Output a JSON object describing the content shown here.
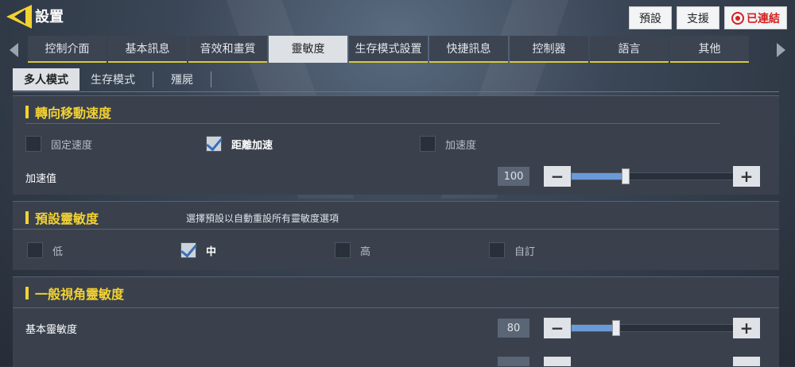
{
  "header": {
    "title": "設置",
    "buttons": [
      "預設",
      "支援"
    ],
    "connected_label": "已連結"
  },
  "tabs": [
    "控制介面",
    "基本訊息",
    "音效和畫質",
    "靈敏度",
    "生存模式設置",
    "快捷訊息",
    "控制器",
    "語言",
    "其他"
  ],
  "active_tab": "靈敏度",
  "subtabs": [
    "多人模式",
    "生存模式",
    "殭屍"
  ],
  "active_subtab": "多人模式",
  "sec1": {
    "title": "轉向移動速度",
    "options": [
      {
        "label": "固定速度",
        "checked": false
      },
      {
        "label": "距離加速",
        "checked": true
      },
      {
        "label": "加速度",
        "checked": false
      }
    ],
    "slider": {
      "label": "加速值",
      "value": "100",
      "fraction": 0.33
    }
  },
  "sec2": {
    "title": "預設靈敏度",
    "hint": "選擇預設以自動重設所有靈敏度選項",
    "options": [
      {
        "label": "低",
        "checked": false
      },
      {
        "label": "中",
        "checked": true
      },
      {
        "label": "高",
        "checked": false
      },
      {
        "label": "自訂",
        "checked": false
      }
    ]
  },
  "sec3": {
    "title": "一般視角靈敏度",
    "slider": {
      "label": "基本靈敏度",
      "value": "80",
      "fraction": 0.27
    }
  },
  "icons": {
    "back": "back-arrow-icon",
    "connection": "connection-icon",
    "check": "checkmark-icon"
  }
}
